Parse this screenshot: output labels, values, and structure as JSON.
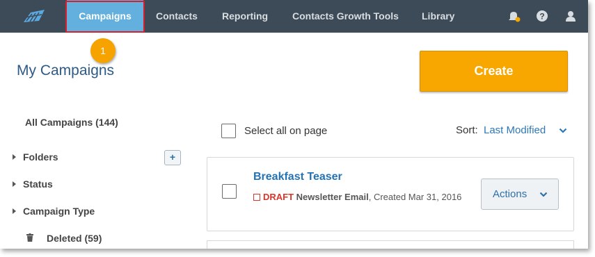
{
  "nav": {
    "items": [
      {
        "label": "Campaigns",
        "active": true
      },
      {
        "label": "Contacts"
      },
      {
        "label": "Reporting"
      },
      {
        "label": "Contacts Growth Tools"
      },
      {
        "label": "Library"
      }
    ],
    "icons": [
      "notifications-icon",
      "help-icon",
      "user-icon"
    ]
  },
  "step_badge": "1",
  "page": {
    "title": "My Campaigns",
    "create_label": "Create"
  },
  "sidebar": {
    "all_campaigns": "All Campaigns (144)",
    "folders": "Folders",
    "status": "Status",
    "campaign_type": "Campaign Type",
    "deleted": "Deleted (59)",
    "add_folder_label": "+"
  },
  "list": {
    "select_all_label": "Select all on page",
    "sort_label": "Sort:",
    "sort_value": "Last Modified"
  },
  "campaigns": [
    {
      "title": "Breakfast Teaser",
      "status": "DRAFT",
      "type": "Newsletter Email",
      "created": ", Created Mar 31, 2016",
      "actions_label": "Actions"
    }
  ],
  "colors": {
    "nav_bg": "#3d4a57",
    "nav_active": "#63b0de",
    "highlight_border": "#d81e2a",
    "accent_orange": "#f7a700",
    "link_blue": "#2473b5",
    "draft_red": "#d9352b"
  }
}
